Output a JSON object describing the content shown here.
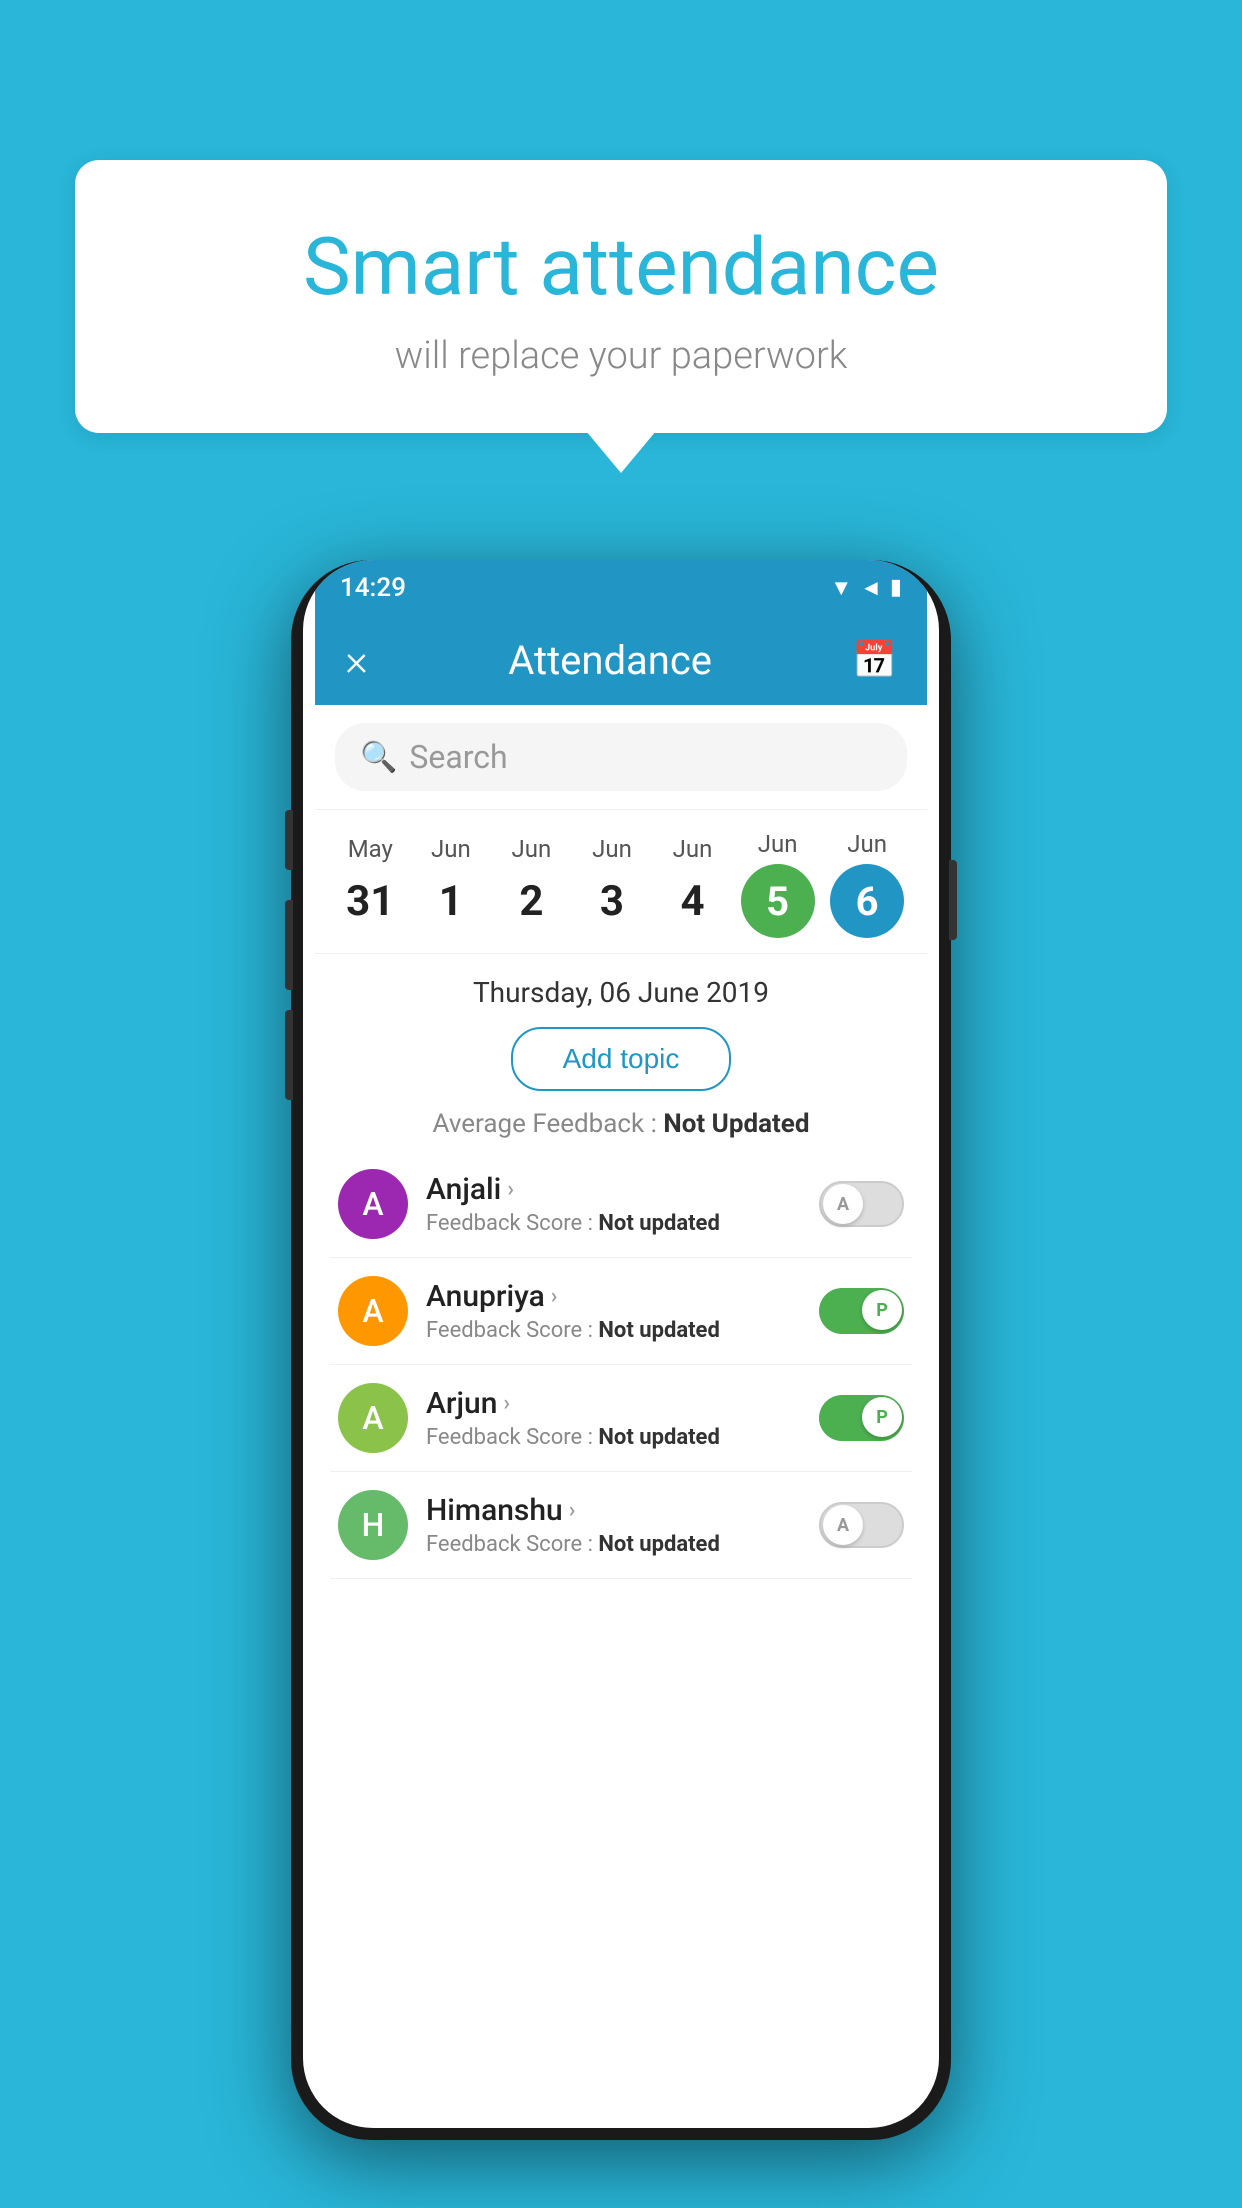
{
  "background": {
    "color": "#29B6D8"
  },
  "bubble": {
    "title": "Smart attendance",
    "subtitle": "will replace your paperwork"
  },
  "status_bar": {
    "time": "14:29",
    "icons": [
      "wifi",
      "signal",
      "battery"
    ]
  },
  "app_bar": {
    "title": "Attendance",
    "close_label": "×",
    "calendar_label": "📅"
  },
  "search": {
    "placeholder": "Search"
  },
  "calendar": {
    "dates": [
      {
        "month": "May",
        "day": "31",
        "selected": false,
        "today": false
      },
      {
        "month": "Jun",
        "day": "1",
        "selected": false,
        "today": false
      },
      {
        "month": "Jun",
        "day": "2",
        "selected": false,
        "today": false
      },
      {
        "month": "Jun",
        "day": "3",
        "selected": false,
        "today": false
      },
      {
        "month": "Jun",
        "day": "4",
        "selected": false,
        "today": false
      },
      {
        "month": "Jun",
        "day": "5",
        "selected": true,
        "today": false,
        "style": "green"
      },
      {
        "month": "Jun",
        "day": "6",
        "selected": true,
        "today": true,
        "style": "blue"
      }
    ]
  },
  "selected_date": "Thursday, 06 June 2019",
  "add_topic_label": "Add topic",
  "average_feedback": {
    "label": "Average Feedback : ",
    "value": "Not Updated"
  },
  "students": [
    {
      "name": "Anjali",
      "avatar_letter": "A",
      "avatar_color": "purple",
      "feedback_label": "Feedback Score : ",
      "feedback_value": "Not updated",
      "attendance": "A",
      "present": false
    },
    {
      "name": "Anupriya",
      "avatar_letter": "A",
      "avatar_color": "orange",
      "feedback_label": "Feedback Score : ",
      "feedback_value": "Not updated",
      "attendance": "P",
      "present": true
    },
    {
      "name": "Arjun",
      "avatar_letter": "A",
      "avatar_color": "green",
      "feedback_label": "Feedback Score : ",
      "feedback_value": "Not updated",
      "attendance": "P",
      "present": true
    },
    {
      "name": "Himanshu",
      "avatar_letter": "H",
      "avatar_color": "teal",
      "feedback_label": "Feedback Score : ",
      "feedback_value": "Not updated",
      "attendance": "A",
      "present": false
    }
  ]
}
